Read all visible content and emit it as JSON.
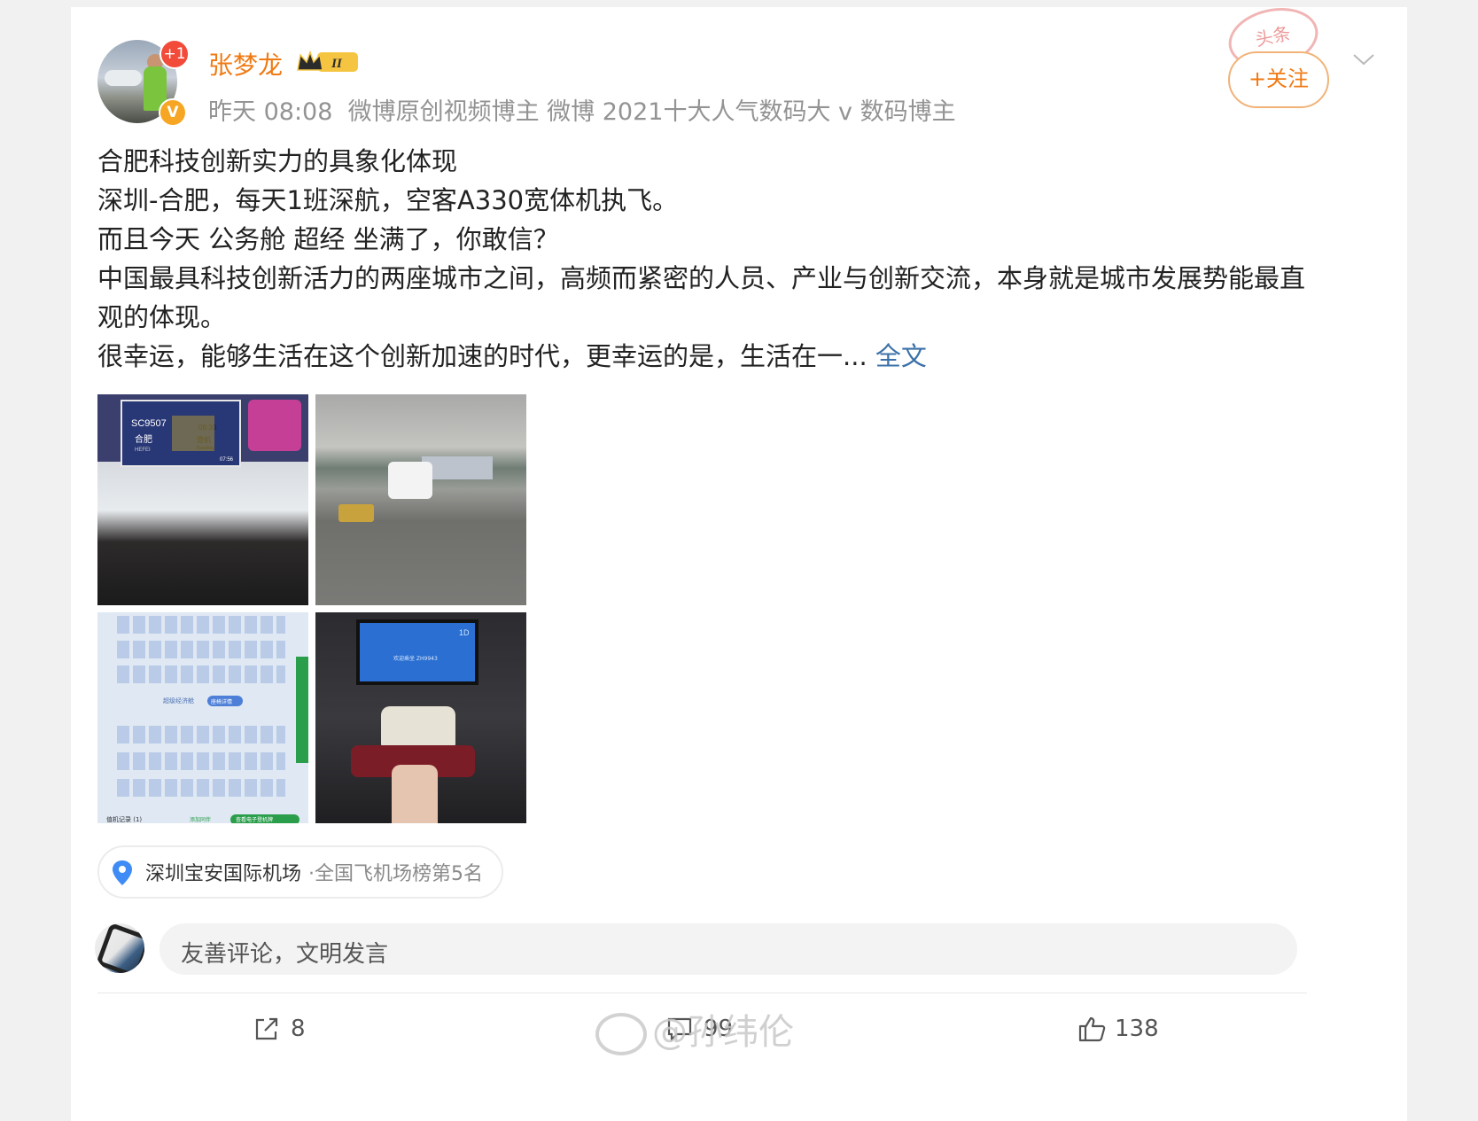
{
  "post": {
    "username": "张梦龙",
    "avatar_badge": "+1",
    "verified_badge": "V",
    "member_level": "II",
    "timestamp": "昨天 08:08",
    "user_tags": "微博原创视频博主 微博 2021十大人气数码大 v 数码博主",
    "stamp_text": "头条",
    "follow_label": "+关注",
    "content": {
      "line1": "合肥科技创新实力的具象化体现",
      "line2": "深圳-合肥，每天1班深航，空客A330宽体机执飞。",
      "line3": "而且今天 公务舱 超经 坐满了，你敢信？",
      "line4": "中国最具科技创新活力的两座城市之间，高频而紧密的人员、产业与创新交流，本身就是城市发展势能最直观的体现。",
      "line5": "很幸运，能够生活在这个创新加速的时代，更幸运的是，生活在一...",
      "more_label": "全文"
    },
    "images": [
      {
        "board_flight": "SC9507",
        "board_time": "08:30",
        "board_dest": "合肥",
        "board_dest_en": "HEFEI",
        "board_status": "登机",
        "board_status_en": "Boarding",
        "clock": "07:56"
      },
      {},
      {
        "class_label": "超级经济舱",
        "detail_label": "座椅详情",
        "bottom_left": "值机记录 (1)",
        "bottom_mid": "添加同伴",
        "bottom_right": "查看电子登机牌"
      },
      {
        "seat_no": "1D",
        "screen_text": "欢迎乘坐 ZH9943"
      }
    ],
    "location": {
      "name": "深圳宝安国际机场",
      "rank": "·全国飞机场榜第5名"
    }
  },
  "comment": {
    "placeholder": "友善评论，文明发言"
  },
  "actions": {
    "repost_count": "8",
    "comment_count": "99",
    "like_count": "138"
  },
  "watermark": "@孙纬伦",
  "colors": {
    "username": "#f07a13",
    "link": "#3b70a8",
    "meta": "#939393"
  }
}
